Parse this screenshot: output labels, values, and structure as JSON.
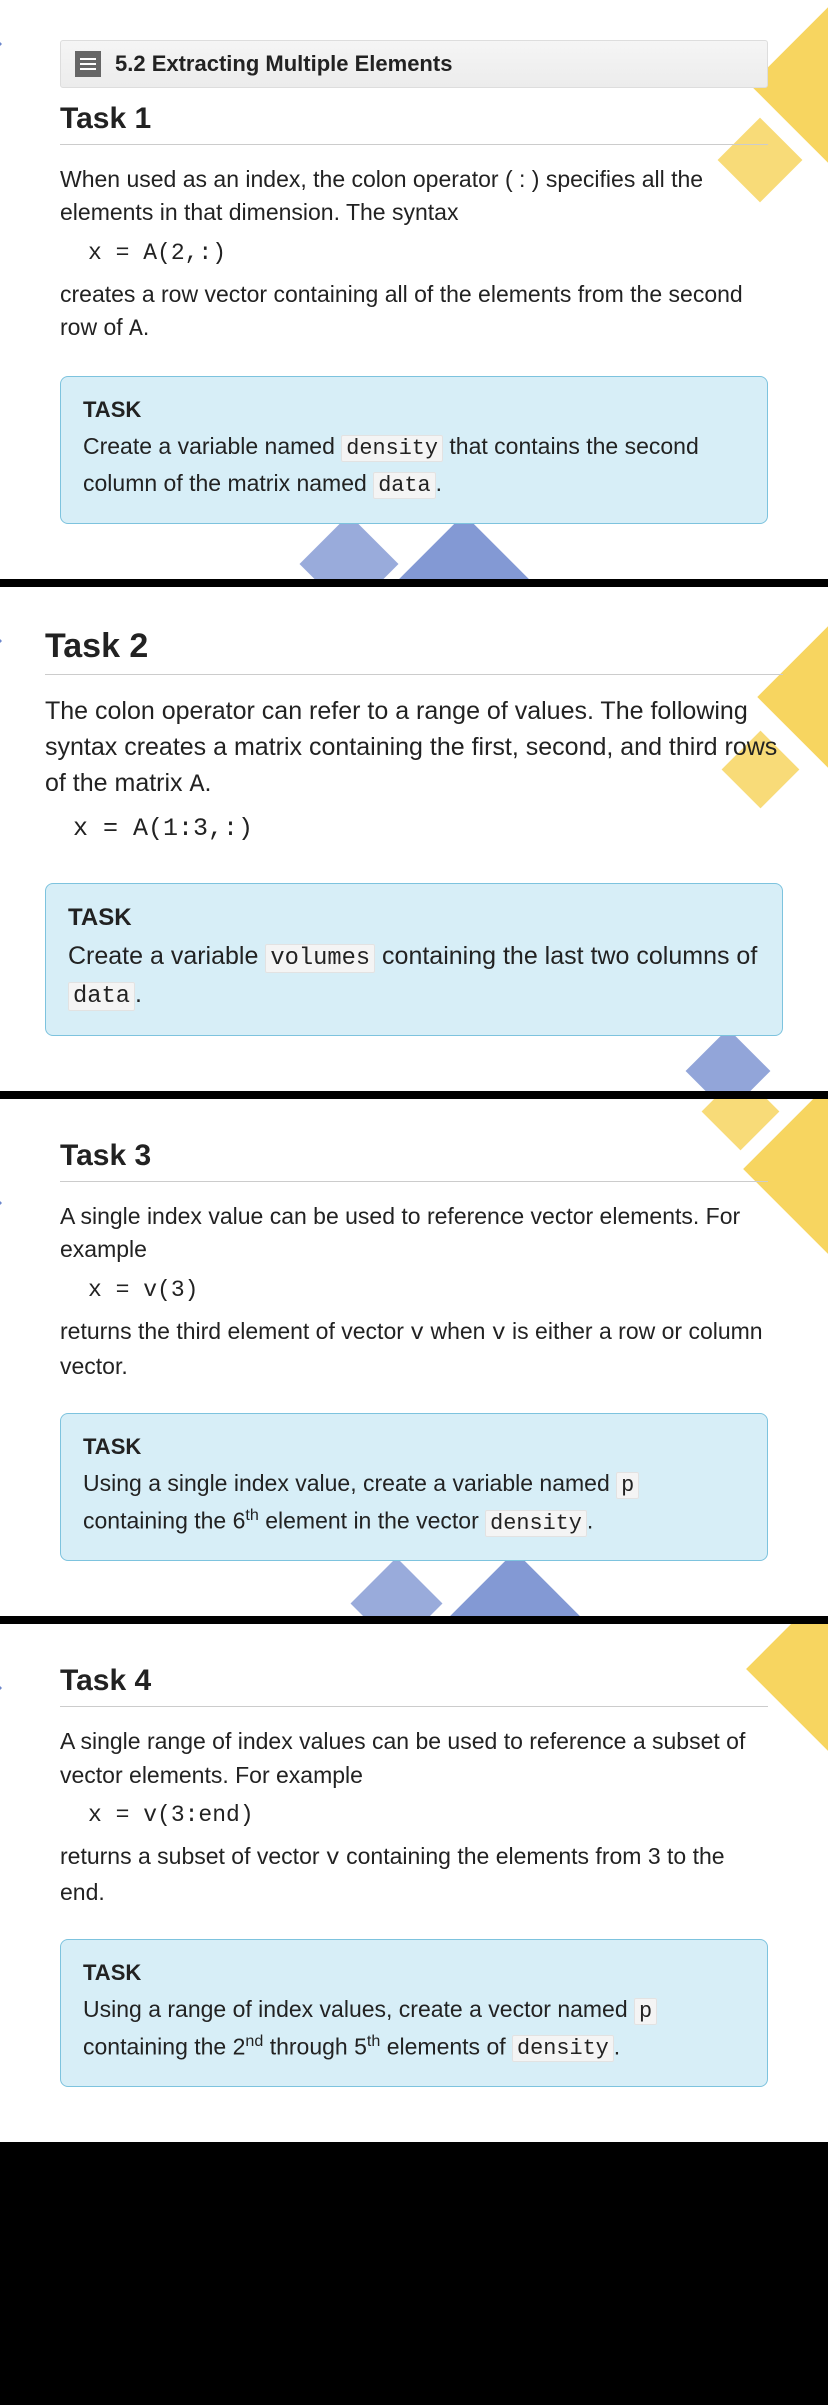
{
  "section_header": "5.2 Extracting Multiple Elements",
  "tasks": [
    {
      "title": "Task 1",
      "intro_a": "When used as an index, the colon operator ( : ) specifies all the elements in that dimension. The syntax",
      "code": "x = A(2,:)",
      "intro_b_1": "creates a row vector containing all of the elements from the second row of ",
      "intro_b_code": "A",
      "intro_b_2": ".",
      "task_label": "TASK",
      "task_parts": [
        "Create a variable named ",
        "density",
        " that contains the second column of the matrix named ",
        "data",
        "."
      ]
    },
    {
      "title": "Task 2",
      "intro_a_1": "The colon operator can refer to a range of values. The following syntax creates a matrix containing the first, second, and third rows of the matrix ",
      "intro_a_code": "A",
      "intro_a_2": ".",
      "code": "x = A(1:3,:)",
      "task_label": "TASK",
      "task_parts": [
        "Create a variable ",
        "volumes",
        " containing the last two columns of ",
        "data",
        "."
      ]
    },
    {
      "title": "Task 3",
      "intro_a": "A single index value can be used to reference vector elements. For example",
      "code": "x = v(3)",
      "intro_b_1": "returns the third element of vector ",
      "intro_b_code1": "v",
      "intro_b_2": " when ",
      "intro_b_code2": "v",
      "intro_b_3": " is either a row or column vector.",
      "task_label": "TASK",
      "task_p1": "Using a single index value, create a variable named ",
      "task_code1": "p",
      "task_p2": " containing the 6",
      "task_sup": "th",
      "task_p3": " element in the vector ",
      "task_code2": "density",
      "task_p4": "."
    },
    {
      "title": "Task 4",
      "intro_a": "A single range of index values can be used to reference a subset of vector elements. For example",
      "code": "x = v(3:end)",
      "intro_b_1": "returns a subset of vector ",
      "intro_b_code": "v",
      "intro_b_2": " containing the elements from 3 to the end.",
      "task_label": "TASK",
      "task_p1": "Using a range of index values, create a vector named ",
      "task_code1": "p",
      "task_p2": " containing the 2",
      "task_sup1": "nd",
      "task_p3": " through 5",
      "task_sup2": "th",
      "task_p4": " elements of ",
      "task_code2": "density",
      "task_p5": "."
    }
  ]
}
